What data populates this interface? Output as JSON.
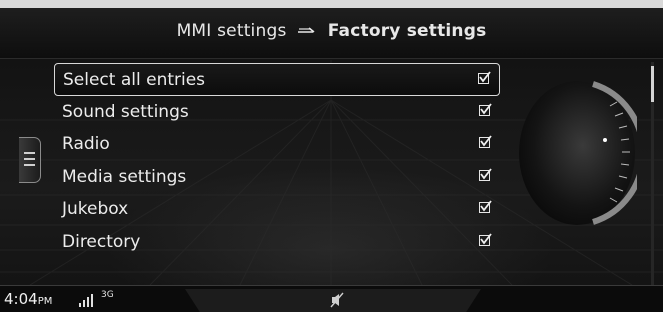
{
  "header": {
    "parent": "MMI settings",
    "current": "Factory settings",
    "separator_icon": "arrow-right-icon"
  },
  "list": {
    "items": [
      {
        "label": "Select all entries",
        "checked": true,
        "selected": true
      },
      {
        "label": "Sound settings",
        "checked": true
      },
      {
        "label": "Radio",
        "checked": true
      },
      {
        "label": "Media settings",
        "checked": true
      },
      {
        "label": "Jukebox",
        "checked": true
      },
      {
        "label": "Directory",
        "checked": true
      }
    ]
  },
  "status": {
    "time": "4:04",
    "ampm": "PM",
    "network": "3G",
    "signal_icon": "signal-bars-icon",
    "mute_icon": "mute-icon"
  },
  "colors": {
    "text": "#ececec",
    "background": "#141414",
    "highlight_border": "#d8d8d8"
  }
}
